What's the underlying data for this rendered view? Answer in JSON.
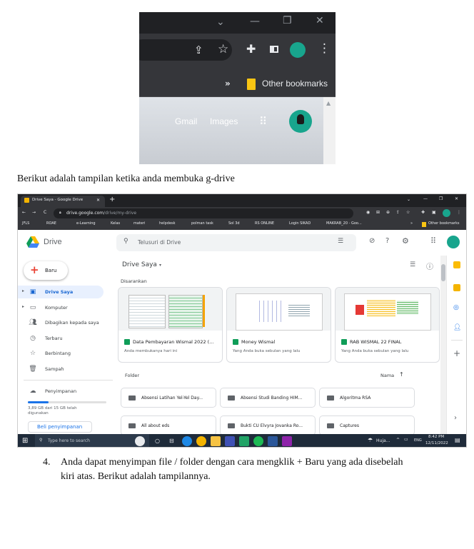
{
  "top_screenshot": {
    "bookmarks_overflow": "»",
    "other_bookmarks": "Other bookmarks",
    "gmail_link": "Gmail",
    "images_link": "Images"
  },
  "caption_1": "Berikut adalah tampilan ketika anda membuka g-drive",
  "browser": {
    "tab_title": "Drive Saya - Google Drive",
    "address_domain": "drive.google.com",
    "address_path": "/drive/my-drive",
    "bookmarks": [
      "JFLS",
      "ROAE",
      "e-Learning",
      "Kelas",
      "materi",
      "helpdesk",
      "polman task",
      "Sol 3d",
      "RS ONLINE",
      "Login SIKAD",
      "MAKRAB_20 - Goo..."
    ],
    "other_bookmarks": "Other bookmarks",
    "bookmarks_overflow": "»"
  },
  "drive": {
    "brand": "Drive",
    "search_placeholder": "Telusuri di Drive",
    "new_button": "Baru",
    "sidebar": [
      {
        "label": "Drive Saya",
        "active": true
      },
      {
        "label": "Komputer"
      },
      {
        "label": "Dibagikan kepada saya"
      },
      {
        "label": "Terbaru"
      },
      {
        "label": "Berbintang"
      },
      {
        "label": "Sampah"
      }
    ],
    "storage_label": "Penyimpanan",
    "storage_used": "3,89 GB dari 15 GB telah digunakan",
    "storage_fraction": 0.26,
    "buy_storage": "Beli penyimpanan",
    "title": "Drive Saya",
    "suggested_label": "Disarankan",
    "suggested": [
      {
        "name": "Data Pembayaran Wismal 2022 (...",
        "sub": "Anda membukanya hari ini"
      },
      {
        "name": "Money Wismal",
        "sub": "Yang Anda buka sebulan yang lalu"
      },
      {
        "name": "RAB WISMAL 22 FINAL",
        "sub": "Yang Anda buka sebulan yang lalu"
      }
    ],
    "folders_label": "Folder",
    "sort_label": "Nama",
    "sort_arrow": "↑",
    "folders": [
      "Absensi Latihan Yel-Yel Day...",
      "Absensi Studi Banding HIM...",
      "Algoritma RSA",
      "All about eds",
      "Bukti CU Elvyra Jovanka Ro...",
      "Captures"
    ]
  },
  "taskbar": {
    "search_placeholder": "Type here to search",
    "weather": "Huja...",
    "lang": "ENG",
    "time": "8:42 PM",
    "date": "12/11/2022"
  },
  "list_item": {
    "number": "4.",
    "line1": "Anda dapat menyimpan file / folder dengan cara mengklik + Baru yang ada disebelah",
    "line2": "kiri atas. Berikut adalah tampilannya."
  }
}
